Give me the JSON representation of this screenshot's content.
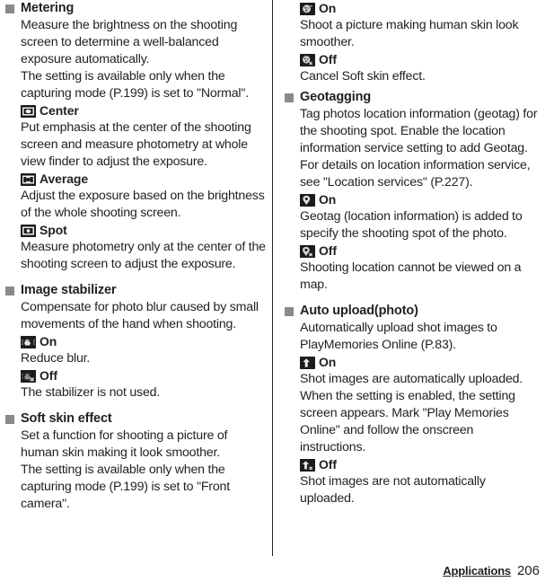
{
  "page": {
    "footer_chapter": "Applications",
    "footer_page": "206"
  },
  "left_column": {
    "sections": [
      {
        "title": "Metering",
        "paragraphs": [
          "Measure the brightness on the shooting screen to determine a well-balanced exposure automatically.",
          "The setting is available only when the capturing mode (P.199) is set to \"Normal\"."
        ],
        "options": [
          {
            "icon": "metering-center-icon",
            "label": "Center",
            "description": "Put emphasis at the center of the shooting screen and measure photometry at whole view finder to adjust the exposure."
          },
          {
            "icon": "metering-average-icon",
            "label": "Average",
            "description": "Adjust the exposure based on the brightness of the whole shooting screen."
          },
          {
            "icon": "metering-spot-icon",
            "label": "Spot",
            "description": "Measure photometry only at the center of the shooting screen to adjust the exposure."
          }
        ]
      },
      {
        "title": "Image stabilizer",
        "paragraphs": [
          "Compensate for photo blur caused by small movements of the hand when shooting."
        ],
        "options": [
          {
            "icon": "stabilizer-on-icon",
            "label": "On",
            "description": "Reduce blur."
          },
          {
            "icon": "stabilizer-off-icon",
            "label": "Off",
            "description": "The stabilizer is not used."
          }
        ]
      },
      {
        "title": "Soft skin effect",
        "paragraphs": [
          "Set a function for shooting a picture of human skin making it look smoother.",
          "The setting is available only when the capturing mode (P.199) is set to \"Front camera\"."
        ],
        "options": []
      }
    ]
  },
  "right_column": {
    "continued_options": [
      {
        "icon": "soft-skin-on-icon",
        "label": "On",
        "description": "Shoot a picture making human skin look smoother."
      },
      {
        "icon": "soft-skin-off-icon",
        "label": "Off",
        "description": "Cancel Soft skin effect."
      }
    ],
    "sections": [
      {
        "title": "Geotagging",
        "paragraphs": [
          "Tag photos location information (geotag) for the shooting spot. Enable the location information service setting to add Geotag. For details on location information service, see \"Location services\" (P.227)."
        ],
        "options": [
          {
            "icon": "geotag-on-icon",
            "label": "On",
            "description": "Geotag (location information) is added to specify the shooting spot of the photo."
          },
          {
            "icon": "geotag-off-icon",
            "label": "Off",
            "description": "Shooting location cannot be viewed on a map."
          }
        ]
      },
      {
        "title": "Auto upload(photo)",
        "paragraphs": [
          "Automatically upload shot images to PlayMemories Online (P.83)."
        ],
        "options": [
          {
            "icon": "upload-on-icon",
            "label": "On",
            "description": "Shot images are automatically uploaded. When the setting is enabled, the setting screen appears. Mark \"Play Memories Online\" and follow the onscreen instructions."
          },
          {
            "icon": "upload-off-icon",
            "label": "Off",
            "description": "Shot images are not automatically uploaded."
          }
        ]
      }
    ]
  },
  "colors": {
    "text": "#231f20",
    "bullet": "#8a8a8a",
    "icon_bg": "#1c1c1c",
    "divider": "#231f20"
  }
}
